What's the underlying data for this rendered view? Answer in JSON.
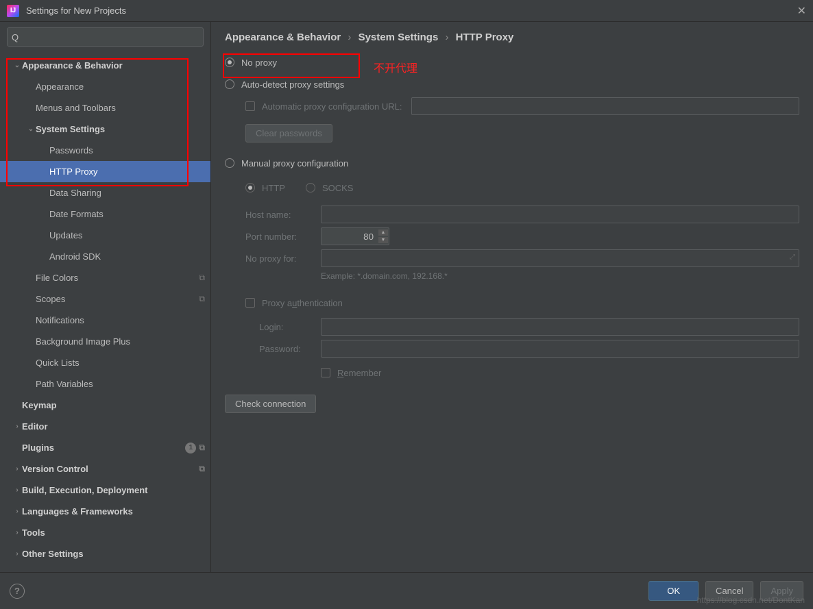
{
  "window": {
    "title": "Settings for New Projects",
    "logo_text": "IJ"
  },
  "search": {
    "placeholder": ""
  },
  "sidebar": {
    "items": [
      {
        "label": "Appearance & Behavior",
        "bold": true,
        "arrow": "v",
        "indent": 0
      },
      {
        "label": "Appearance",
        "indent": 1
      },
      {
        "label": "Menus and Toolbars",
        "indent": 1
      },
      {
        "label": "System Settings",
        "bold": true,
        "arrow": "v",
        "indent": 1
      },
      {
        "label": "Passwords",
        "indent": 2
      },
      {
        "label": "HTTP Proxy",
        "indent": 2,
        "selected": true
      },
      {
        "label": "Data Sharing",
        "indent": 2
      },
      {
        "label": "Date Formats",
        "indent": 2
      },
      {
        "label": "Updates",
        "indent": 2
      },
      {
        "label": "Android SDK",
        "indent": 2
      },
      {
        "label": "File Colors",
        "indent": 1,
        "copy": true
      },
      {
        "label": "Scopes",
        "indent": 1,
        "copy": true
      },
      {
        "label": "Notifications",
        "indent": 1
      },
      {
        "label": "Background Image Plus",
        "indent": 1
      },
      {
        "label": "Quick Lists",
        "indent": 1
      },
      {
        "label": "Path Variables",
        "indent": 1
      },
      {
        "label": "Keymap",
        "bold": true,
        "indent": 0
      },
      {
        "label": "Editor",
        "bold": true,
        "arrow": ">",
        "indent": 0
      },
      {
        "label": "Plugins",
        "bold": true,
        "indent": 0,
        "badge": "1",
        "copy": true
      },
      {
        "label": "Version Control",
        "bold": true,
        "arrow": ">",
        "indent": 0,
        "copy": true
      },
      {
        "label": "Build, Execution, Deployment",
        "bold": true,
        "arrow": ">",
        "indent": 0
      },
      {
        "label": "Languages & Frameworks",
        "bold": true,
        "arrow": ">",
        "indent": 0
      },
      {
        "label": "Tools",
        "bold": true,
        "arrow": ">",
        "indent": 0
      },
      {
        "label": "Other Settings",
        "bold": true,
        "arrow": ">",
        "indent": 0
      }
    ]
  },
  "breadcrumb": {
    "a": "Appearance & Behavior",
    "b": "System Settings",
    "c": "HTTP Proxy"
  },
  "proxy": {
    "no_proxy": "No proxy",
    "auto_detect": "Auto-detect proxy settings",
    "auto_url_label": "Automatic proxy configuration URL:",
    "clear_passwords": "Clear passwords",
    "manual": "Manual proxy configuration",
    "http": "HTTP",
    "socks": "SOCKS",
    "host_label": "Host name:",
    "port_label": "Port number:",
    "port_value": "80",
    "noproxyfor_label": "No proxy for:",
    "example": "Example: *.domain.com, 192.168.*",
    "auth_label": "Proxy authentication",
    "login_label": "Login:",
    "password_label": "Password:",
    "remember": "Remember",
    "check": "Check connection"
  },
  "annotation": {
    "text": "不开代理"
  },
  "footer": {
    "help": "?",
    "ok": "OK",
    "cancel": "Cancel",
    "apply": "Apply"
  },
  "watermark": "https://blog.csdn.net/DontKan"
}
